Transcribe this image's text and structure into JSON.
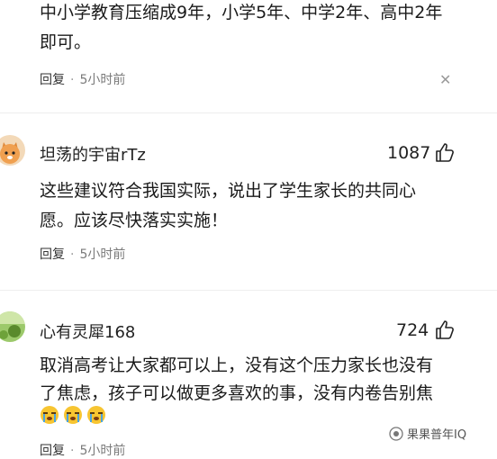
{
  "comments": [
    {
      "lines": [
        "中小学教育压缩成9年，小学5年、中学2年、高中2年",
        "即可。"
      ],
      "reply_label": "回复",
      "time": "5小时前"
    },
    {
      "username": "坦荡的宇宙rTz",
      "likes": "1087",
      "lines": [
        "这些建议符合我国实际，说出了学生家长的共同心",
        "愿。应该尽快落实实施！"
      ],
      "reply_label": "回复",
      "time": "5小时前"
    },
    {
      "username": "心有灵犀168",
      "likes": "724",
      "lines": [
        "取消高考让大家都可以上，没有这个压力家长也没有",
        "了焦虑，孩子可以做更多喜欢的事，没有内卷告别焦"
      ],
      "reply_label": "回复",
      "time": "5小时前"
    }
  ],
  "separator": "·",
  "close_glyph": "✕",
  "watermark": "果果普年IQ"
}
